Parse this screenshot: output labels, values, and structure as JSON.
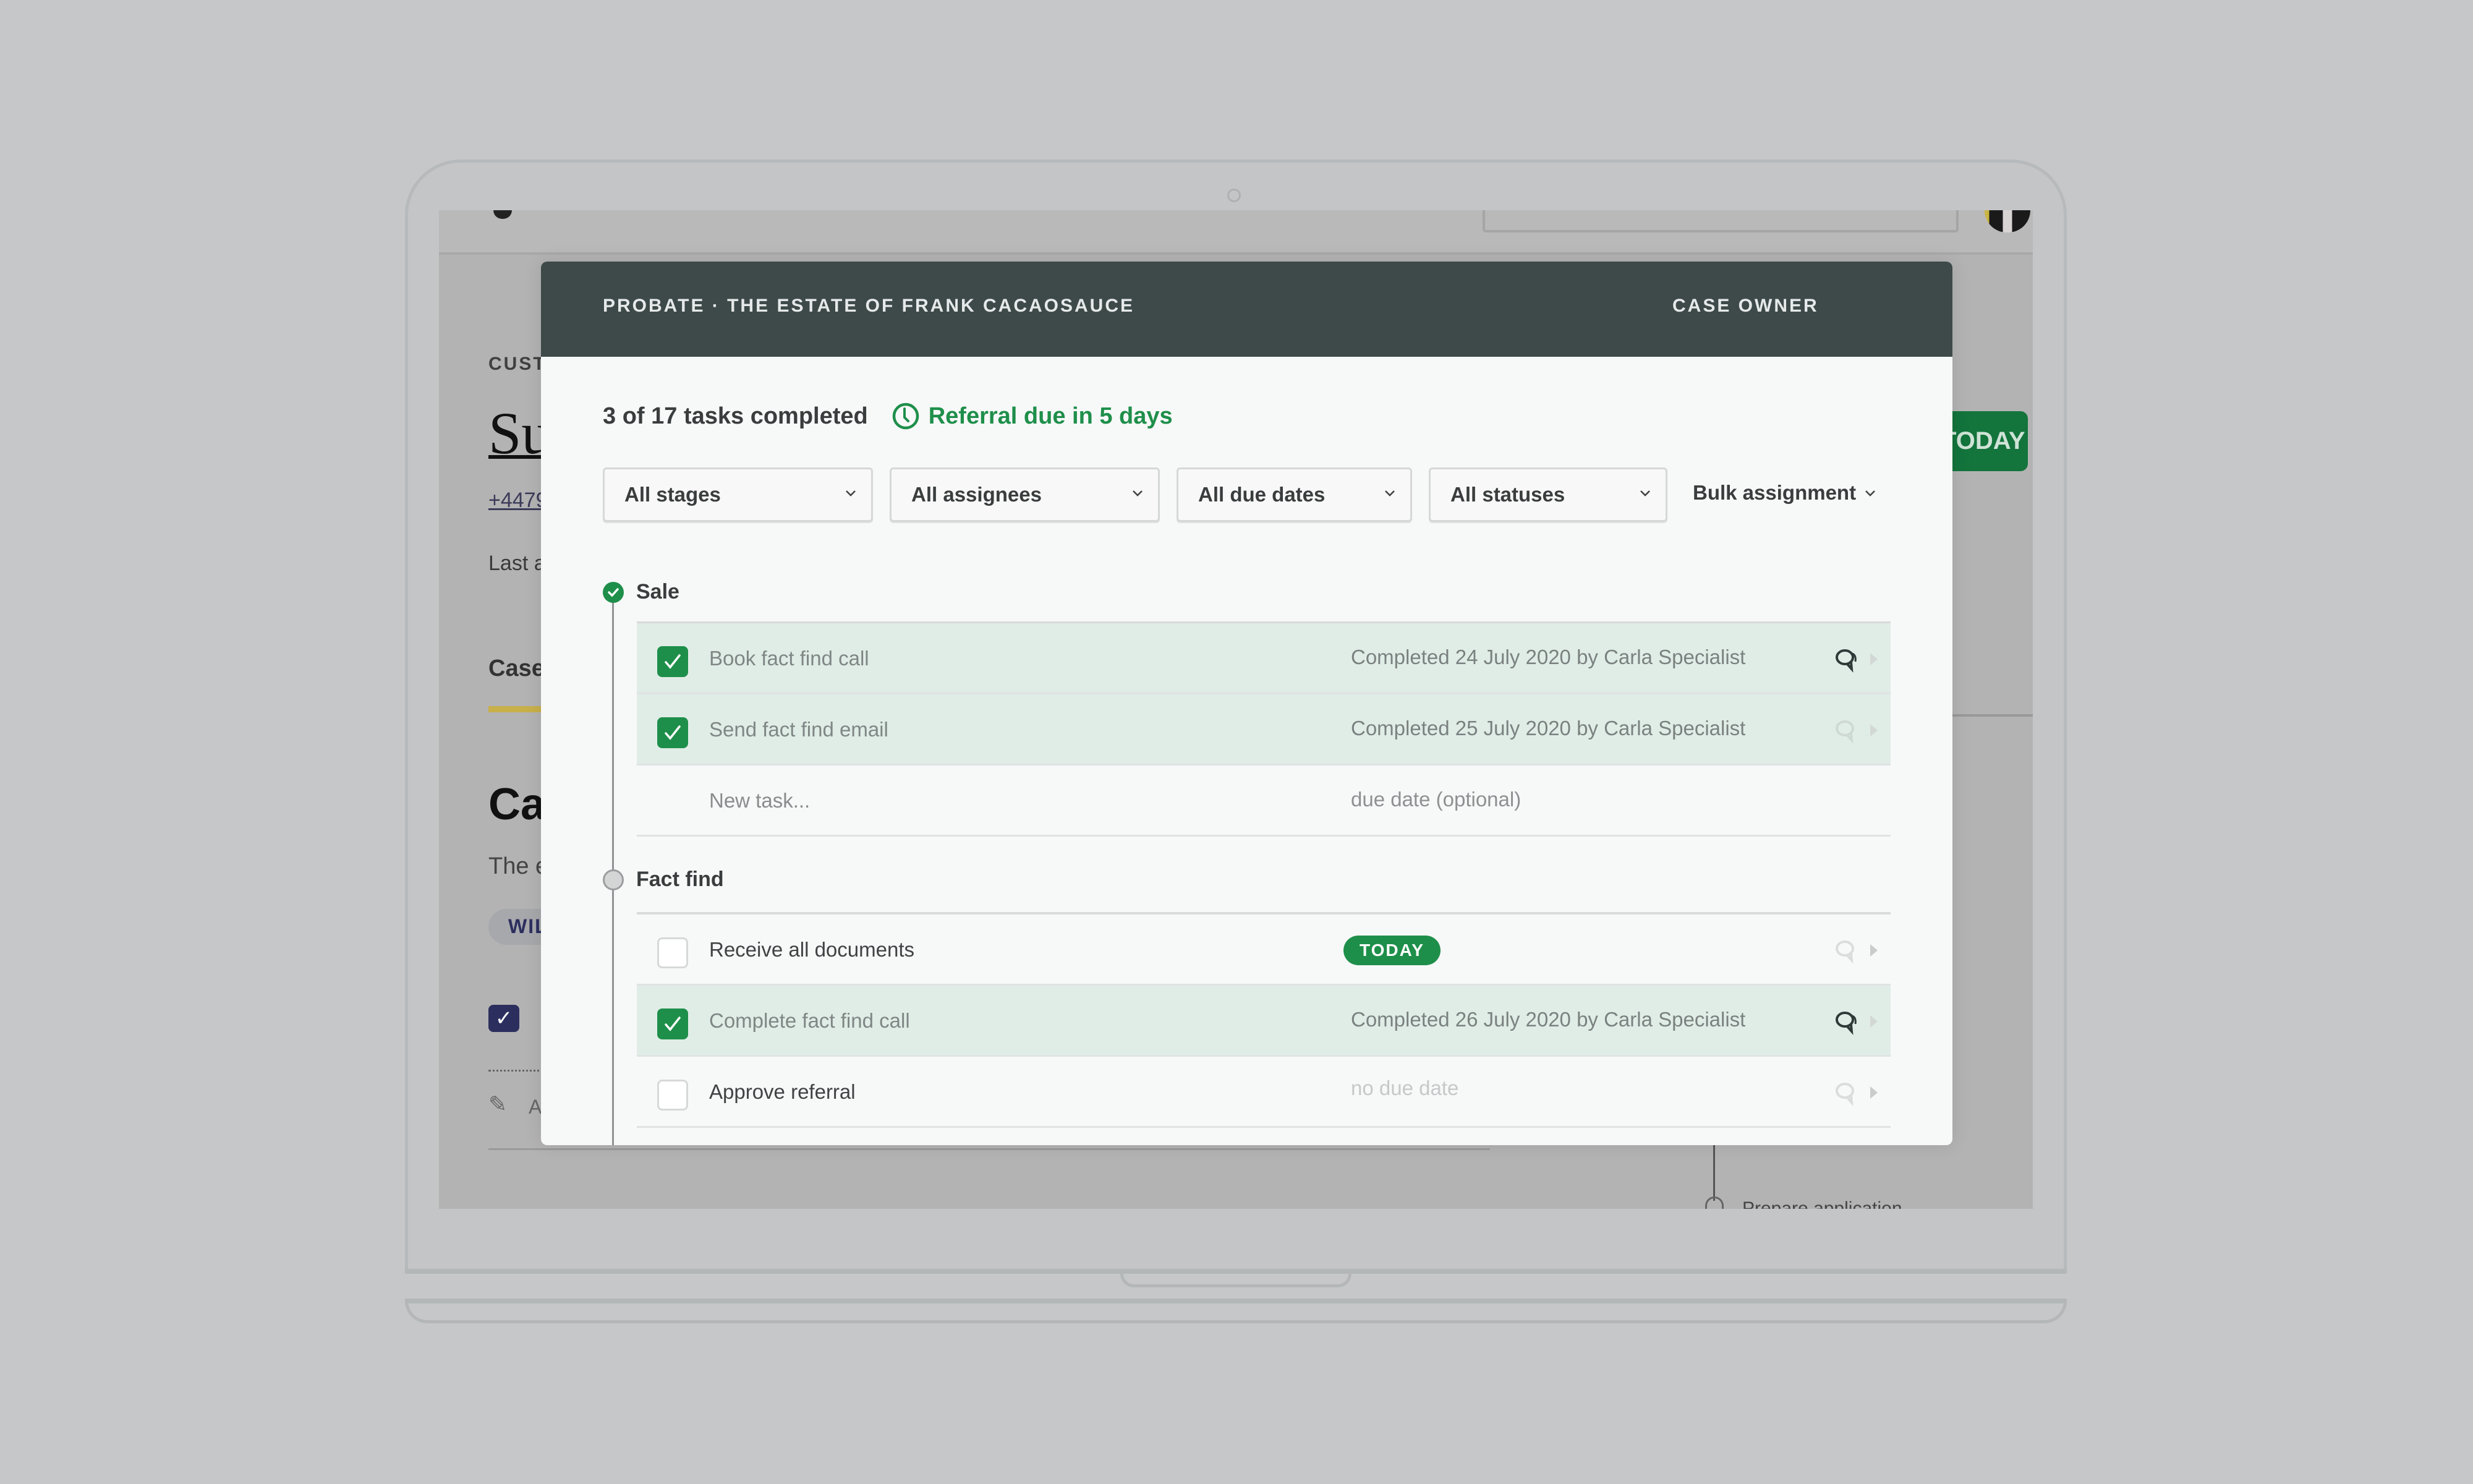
{
  "background_page": {
    "section_label": "CUST",
    "customer_name": "Su",
    "phone": "+4479",
    "last_activity": "Last a",
    "tab": "Case",
    "heading": "Ca",
    "subtext": "The e",
    "pill": "WIL",
    "checkbox_glyph": "✓",
    "edit_glyph": "✎",
    "edit_text": "A",
    "today_button": "TODAY",
    "next_step": "Prepare application"
  },
  "modal": {
    "header": {
      "breadcrumb": "PROBATE · THE ESTATE OF FRANK CACAOSAUCE",
      "case_owner_label": "CASE OWNER"
    },
    "summary": {
      "progress_text": "3 of 17 tasks completed",
      "tasks_completed": 3,
      "tasks_total": 17,
      "referral_due": "Referral due in 5 days"
    },
    "filters": [
      {
        "label": "All stages"
      },
      {
        "label": "All assignees"
      },
      {
        "label": "All due dates"
      },
      {
        "label": "All statuses"
      }
    ],
    "bulk_assignment_label": "Bulk assignment",
    "stages": [
      {
        "name": "Sale",
        "status": "complete",
        "tasks": [
          {
            "title": "Book fact find call",
            "checked": true,
            "meta": "Completed 24 July 2020 by Carla Specialist",
            "has_comments": true
          },
          {
            "title": "Send fact find email",
            "checked": true,
            "meta": "Completed 25 July 2020 by Carla Specialist",
            "has_comments": false
          }
        ],
        "new_task": {
          "placeholder": "New task...",
          "due_placeholder": "due date (optional)"
        }
      },
      {
        "name": "Fact find",
        "status": "pending",
        "tasks": [
          {
            "title": "Receive all documents",
            "checked": false,
            "badge": "TODAY",
            "has_comments": false
          },
          {
            "title": "Complete fact find call",
            "checked": true,
            "meta": "Completed 26 July 2020 by Carla Specialist",
            "has_comments": true
          },
          {
            "title": "Approve referral",
            "checked": false,
            "meta": "no due date",
            "has_comments": false
          }
        ]
      }
    ]
  },
  "colors": {
    "accent_green": "#1e8f4a",
    "header_bg": "#3e4a4a",
    "completed_row_bg": "#e0ede7"
  }
}
